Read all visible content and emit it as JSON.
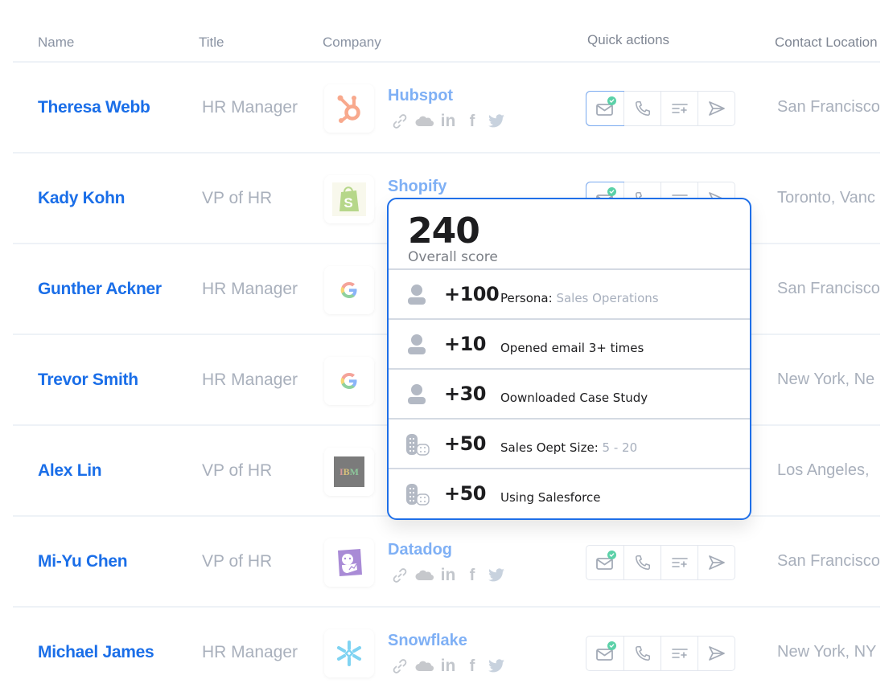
{
  "columns": {
    "name": "Name",
    "title": "Title",
    "company": "Company",
    "quick_actions": "Quick actions",
    "location": "Contact Location"
  },
  "rows": [
    {
      "name": "Theresa Webb",
      "title": "HR Manager",
      "company": "Hubspot",
      "logo": "hubspot-logo",
      "location": "San Francisco",
      "email_verified": true
    },
    {
      "name": "Kady Kohn",
      "title": "VP of HR",
      "company": "Shopify",
      "logo": "shopify-logo",
      "location": "Toronto, Vanc",
      "email_verified": true
    },
    {
      "name": "Gunther Ackner",
      "title": "HR Manager",
      "company": "",
      "logo": "google-logo",
      "location": "San Francisco",
      "email_verified": true
    },
    {
      "name": "Trevor Smith",
      "title": "HR Manager",
      "company": "",
      "logo": "google-logo",
      "location": "New York, Ne",
      "email_verified": true
    },
    {
      "name": "Alex Lin",
      "title": "VP of HR",
      "company": "",
      "logo": "ibm-logo",
      "location": "Los Angeles, ",
      "email_verified": true
    },
    {
      "name": "Mi-Yu Chen",
      "title": "VP of HR",
      "company": "Datadog",
      "logo": "datadog-logo",
      "location": "San Francisco",
      "email_verified": true
    },
    {
      "name": "Michael James",
      "title": "HR Manager",
      "company": "Snowflake",
      "logo": "snowflake-logo",
      "location": "New York, NY",
      "email_verified": true
    }
  ],
  "socials": {
    "linkedin": "in",
    "facebook": "f"
  },
  "logos": {
    "ibm": "IBM"
  },
  "popover": {
    "score": "240",
    "score_label": "Overall score",
    "items": [
      {
        "icon": "person-icon",
        "points": "+100",
        "label": "Persona:",
        "value": "Sales Operations"
      },
      {
        "icon": "person-icon",
        "points": "+10",
        "label": "Opened email 3+ times",
        "value": ""
      },
      {
        "icon": "person-icon",
        "points": "+30",
        "label": "Oownloaded Case Study",
        "value": ""
      },
      {
        "icon": "company-icon",
        "points": "+50",
        "label": "Sales Oept Size:",
        "value": "5 - 20"
      },
      {
        "icon": "company-icon",
        "points": "+50",
        "label": "Using Salesforce",
        "value": ""
      }
    ]
  },
  "colors": {
    "accent": "#1f6fe8",
    "name_link": "#1a6ee8",
    "company_link": "#7fb0f5",
    "verified": "#5bd1a8",
    "muted_text": "#a9b0bc"
  }
}
